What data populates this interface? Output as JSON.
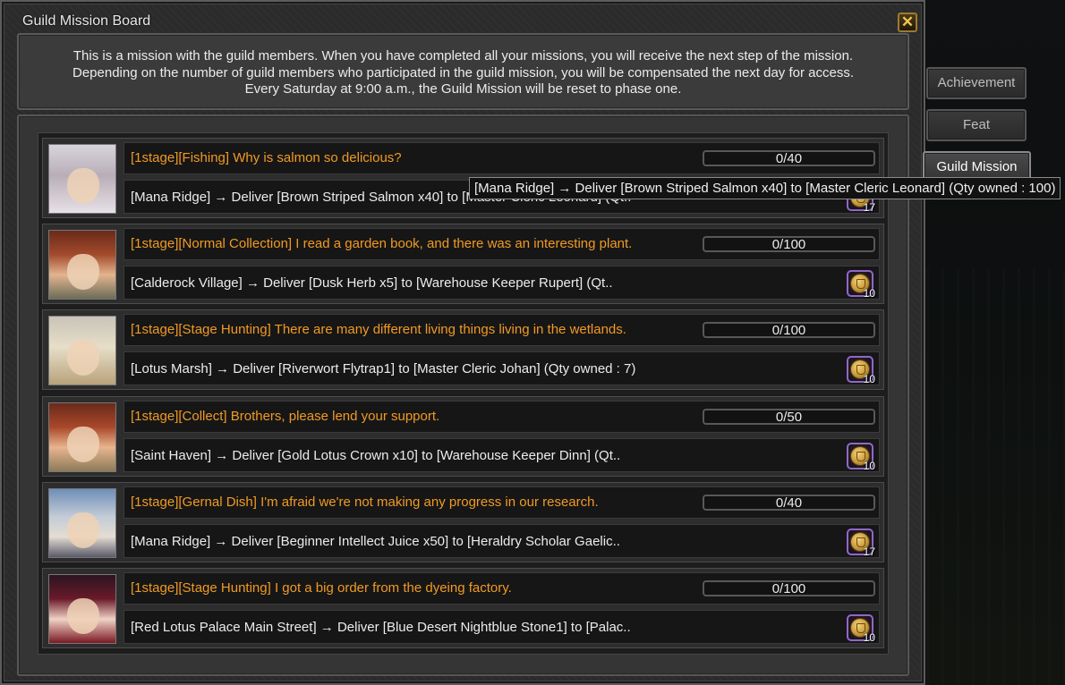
{
  "window": {
    "title": "Guild Mission Board",
    "close_label": "✕"
  },
  "description": {
    "lines": [
      "This is a mission with the guild members. When you have completed all your missions, you will receive the next step of the mission.",
      "Depending on the number of guild members who participated in the guild mission, you will be compensated the next day for access.",
      "Every Saturday at 9:00 a.m., the Guild Mission will be reset to phase one."
    ]
  },
  "tabs": [
    {
      "label": "Achievement",
      "active": false
    },
    {
      "label": "Feat",
      "active": false
    },
    {
      "label": "Guild Mission",
      "active": true
    }
  ],
  "missions": [
    {
      "title": "[1stage][Fishing] Why is salmon so delicious?",
      "progress": "0/40",
      "progress_fraction": 0,
      "detail": "[Mana Ridge] → Deliver [Brown Striped Salmon  x40] to [Master Cleric Leonard] (Qt..",
      "reward_qty": "17",
      "portrait_icon": "npc-portrait-white-hooded"
    },
    {
      "title": "[1stage][Normal Collection] I read a garden book, and there was an interesting plant.",
      "progress": "0/100",
      "progress_fraction": 0,
      "detail": "[Calderock Village] → Deliver [Dusk Herb x5] to [Warehouse Keeper Rupert] (Qt..",
      "reward_qty": "10",
      "portrait_icon": "npc-portrait-red-cap"
    },
    {
      "title": "[1stage][Stage Hunting] There are many different living things living in the wetlands.",
      "progress": "0/100",
      "progress_fraction": 0,
      "detail": "[Lotus Marsh] → Deliver [Riverwort Flytrap1] to [Master Cleric Johan] (Qty owned : 7)",
      "reward_qty": "10",
      "portrait_icon": "npc-portrait-blonde-elf"
    },
    {
      "title": "[1stage][Collect] Brothers, please lend your support.",
      "progress": "0/50",
      "progress_fraction": 0,
      "detail": "[Saint Haven] → Deliver [Gold Lotus Crown x10] to [Warehouse Keeper Dinn] (Qt..",
      "reward_qty": "10",
      "portrait_icon": "npc-portrait-red-cap"
    },
    {
      "title": "[1stage][Gernal Dish] I'm afraid we're not making any progress in our research.",
      "progress": "0/40",
      "progress_fraction": 0,
      "detail": "[Mana Ridge] → Deliver [Beginner Intellect Juice x50] to [Heraldry Scholar Gaelic..",
      "reward_qty": "17",
      "portrait_icon": "npc-portrait-old-scholar"
    },
    {
      "title": "[1stage][Stage Hunting] I got a big order from the dyeing factory.",
      "progress": "0/100",
      "progress_fraction": 0,
      "detail": "[Red Lotus Palace Main Street] → Deliver [Blue Desert Nightblue Stone1] to [Palac..",
      "reward_qty": "10",
      "portrait_icon": "npc-portrait-dark-hair-girl"
    }
  ],
  "tooltip": {
    "text": "[Mana Ridge] → Deliver [Brown Striped Salmon  x40] to [Master Cleric Leonard] (Qty owned : 100)"
  },
  "colors": {
    "mission_title": "#f19a22",
    "text": "#ececec",
    "reward_border": "#8f68c8"
  }
}
